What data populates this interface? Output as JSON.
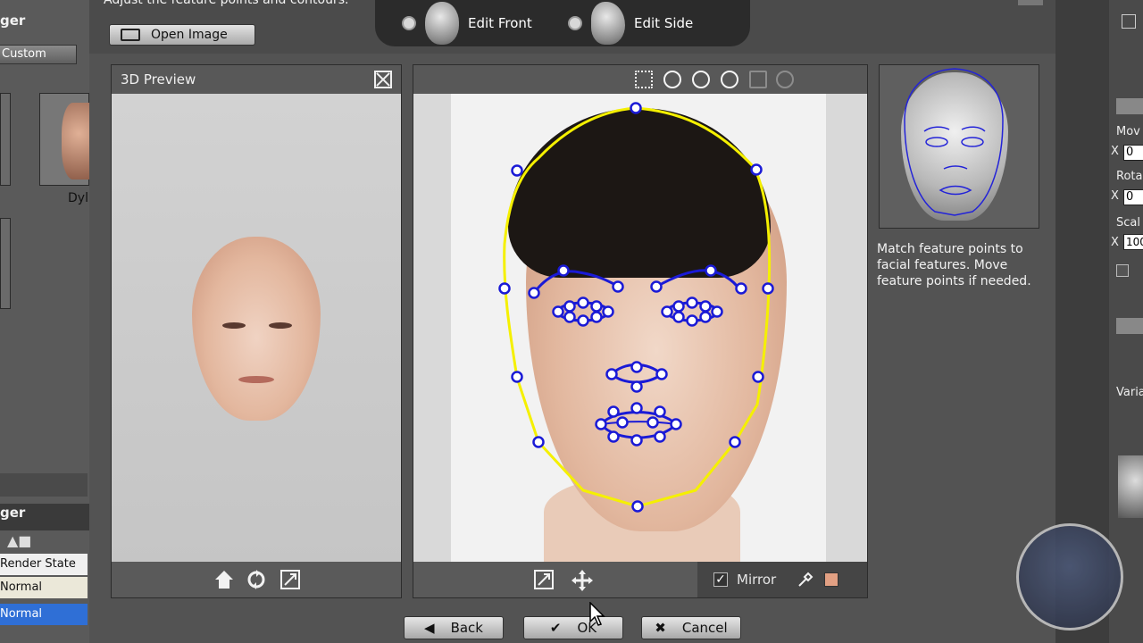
{
  "dialog": {
    "hint": "Adjust the feature points and contours.",
    "open_image_label": "Open Image",
    "tabs": [
      {
        "label": "Edit Front",
        "selected": false
      },
      {
        "label": "Edit Side",
        "selected": false
      }
    ]
  },
  "preview": {
    "title": "3D Preview"
  },
  "image_editor": {
    "mirror_label": "Mirror",
    "mirror_checked": true,
    "swatch_color": "#e2a083"
  },
  "instructions": "Match feature points to facial features. Move feature points if needed.",
  "buttons": {
    "back": "Back",
    "ok": "OK",
    "cancel": "Cancel"
  },
  "left_pane": {
    "title_top": "ger",
    "custom_label": "Custom",
    "thumb_label": "Dyl",
    "title_bottom": "ger",
    "render_state_label": "Render State",
    "row_normal_1": "Normal",
    "row_normal_2": "Normal"
  },
  "right_pane": {
    "move_label": "Mov",
    "move_x": "0",
    "rotate_label": "Rota",
    "rotate_x": "0",
    "scale_label": "Scal",
    "scale_x": "100",
    "vari_label": "Varia",
    "axis_label": "X"
  },
  "colors": {
    "contour": "#f5f000",
    "feature_points": "#1a1ad6"
  }
}
